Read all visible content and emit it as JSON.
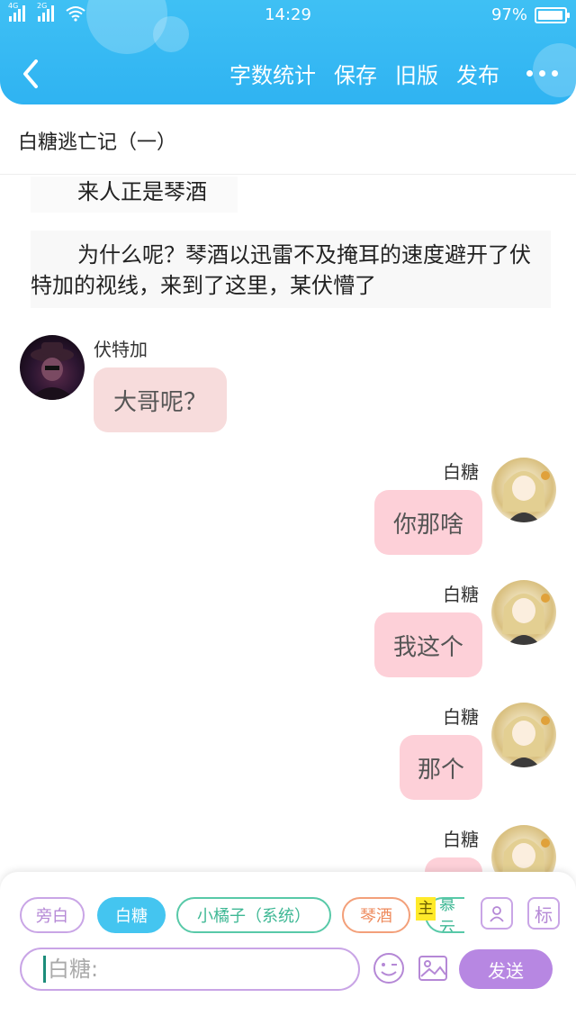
{
  "status_bar": {
    "network_left": "4G",
    "network_right": "2G",
    "time": "14:29",
    "battery": "97%",
    "battery_level": 0.97
  },
  "header": {
    "toolbar": {
      "word_count": "字数统计",
      "save": "保存",
      "old_version": "旧版",
      "publish": "发布"
    }
  },
  "story": {
    "title": "白糖逃亡记（一）"
  },
  "narration": [
    "来人正是琴酒",
    "为什么呢？琴酒以迅雷不及掩耳的速度避开了伏特加的视线，来到了这里，某伏懵了"
  ],
  "messages": [
    {
      "name": "伏特加",
      "text": "大哥呢？",
      "side": "left"
    },
    {
      "name": "白糖",
      "text": "你那啥",
      "side": "right"
    },
    {
      "name": "白糖",
      "text": "我这个",
      "side": "right"
    },
    {
      "name": "白糖",
      "text": "那个",
      "side": "right"
    },
    {
      "name": "白糖",
      "text": "",
      "side": "right"
    }
  ],
  "characters": {
    "narration": "旁白",
    "baitang": "白糖",
    "orange": "小橘子（系统）",
    "qinjiu": "琴酒",
    "main_tag": "主",
    "partial": "慕云"
  },
  "icons": {
    "role": "role-card-icon",
    "mark": "标",
    "emoji": "emoji-icon",
    "image": "image-icon"
  },
  "input": {
    "placeholder": "白糖:",
    "value": ""
  },
  "send_label": "发送",
  "colors": {
    "header": "#38b9f3",
    "selected_chip": "#44c5f0",
    "send_button": "#b787e2",
    "bubble_right": "#fdd0d8",
    "bubble_left": "#f7dcdc"
  }
}
